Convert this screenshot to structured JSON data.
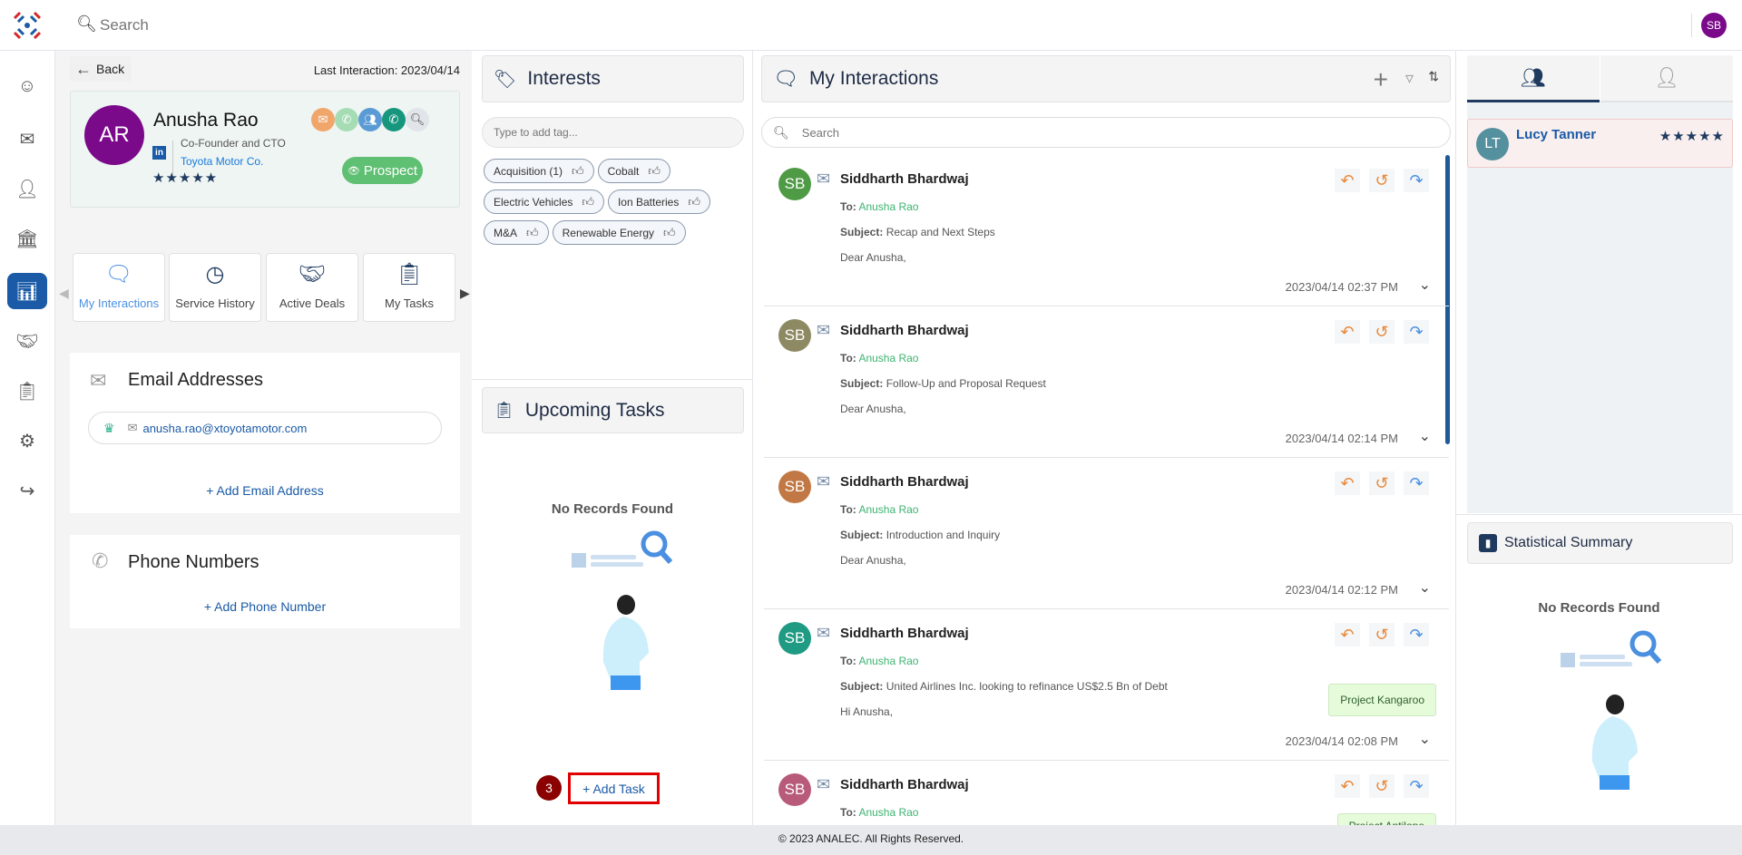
{
  "topbar": {
    "search_placeholder": "Search",
    "user_initials": "SB"
  },
  "profile": {
    "back_label": "Back",
    "last_interaction": "Last Interaction: 2023/04/14",
    "initials": "AR",
    "name": "Anusha Rao",
    "title": "Co-Founder and CTO",
    "company": "Toyota Motor Co.",
    "rating": 5,
    "status": "Prospect",
    "linkedin": "in"
  },
  "tabs": [
    {
      "label": "My Interactions",
      "active": true
    },
    {
      "label": "Service History"
    },
    {
      "label": "Active Deals"
    },
    {
      "label": "My Tasks"
    }
  ],
  "email": {
    "title": "Email Addresses",
    "address": "anusha.rao@xtoyotamotor.com",
    "add_label": "+ Add Email Address"
  },
  "phone": {
    "title": "Phone Numbers",
    "add_label": "+ Add Phone Number"
  },
  "interests": {
    "title": "Interests",
    "placeholder": "Type to add tag...",
    "tags": [
      "Acquisition (1)",
      "Cobalt",
      "Electric Vehicles",
      "Ion Batteries",
      "M&A",
      "Renewable Energy"
    ]
  },
  "tasks": {
    "title": "Upcoming Tasks",
    "empty": "No Records Found",
    "add_label": "+ Add Task",
    "badge": "3"
  },
  "interactions": {
    "title": "My Interactions",
    "search_placeholder": "Search",
    "to_label": "To:",
    "subject_label": "Subject:",
    "items": [
      {
        "initials": "SB",
        "color": "#4e9a45",
        "sender": "Siddharth Bhardwaj",
        "to": "Anusha Rao",
        "subject": "Recap and Next Steps",
        "greeting": "Dear Anusha,",
        "time": "2023/04/14 02:37 PM",
        "project": ""
      },
      {
        "initials": "SB",
        "color": "#8d8a63",
        "sender": "Siddharth Bhardwaj",
        "to": "Anusha Rao",
        "subject": "Follow-Up and Proposal Request",
        "greeting": "Dear Anusha,",
        "time": "2023/04/14 02:14 PM",
        "project": ""
      },
      {
        "initials": "SB",
        "color": "#c27844",
        "sender": "Siddharth Bhardwaj",
        "to": "Anusha Rao",
        "subject": "Introduction and Inquiry",
        "greeting": "Dear Anusha,",
        "time": "2023/04/14 02:12 PM",
        "project": ""
      },
      {
        "initials": "SB",
        "color": "#1f9a83",
        "sender": "Siddharth Bhardwaj",
        "to": "Anusha Rao",
        "subject": "United Airlines Inc. looking to refinance US$2.5 Bn of Debt",
        "greeting": "Hi Anusha,",
        "time": "2023/04/14 02:08 PM",
        "project": "Project Kangaroo"
      },
      {
        "initials": "SB",
        "color": "#b85a7a",
        "sender": "Siddharth Bhardwaj",
        "to": "Anusha Rao",
        "subject": "",
        "greeting": "",
        "time": "",
        "project": "Project Antilope"
      }
    ]
  },
  "right": {
    "contact": {
      "initials": "LT",
      "name": "Lucy Tanner",
      "rating": 5
    },
    "stats_title": "Statistical Summary",
    "stats_empty": "No Records Found"
  },
  "footer": {
    "text": "© 2023 ANALEC. All Rights Reserved."
  },
  "colors": {
    "primary": "#1a5aa6",
    "navy": "#1e3a5f",
    "prospect": "#5fbf72",
    "highlight": "#e00000",
    "badge": "#8b0000"
  }
}
